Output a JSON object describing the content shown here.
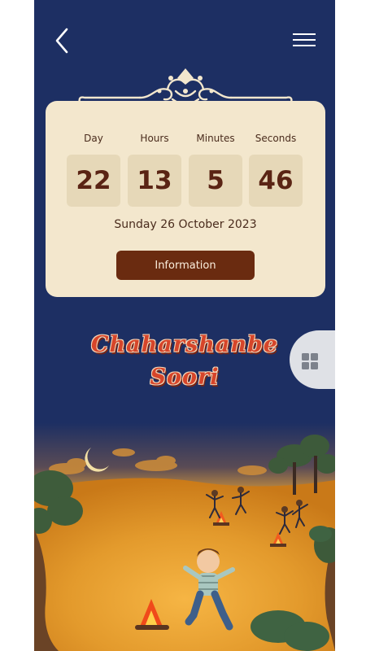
{
  "header": {
    "back_icon": "chevron-left-icon",
    "menu_icon": "hamburger-menu-icon"
  },
  "countdown": {
    "units": [
      {
        "label": "Day",
        "value": "22"
      },
      {
        "label": "Hours",
        "value": "13"
      },
      {
        "label": "Minutes",
        "value": "5"
      },
      {
        "label": "Seconds",
        "value": "46"
      }
    ],
    "date": "Sunday 26 October 2023",
    "button_label": "Information"
  },
  "event": {
    "title_line1": "Chaharshanbe",
    "title_line2": "Soori"
  },
  "side_tab": {
    "icon": "grid-icon"
  },
  "colors": {
    "background": "#1d2f63",
    "card": "#f3e7cd",
    "unit_box": "#e6d8b8",
    "button": "#6a2b10",
    "title": "#d6452a"
  }
}
